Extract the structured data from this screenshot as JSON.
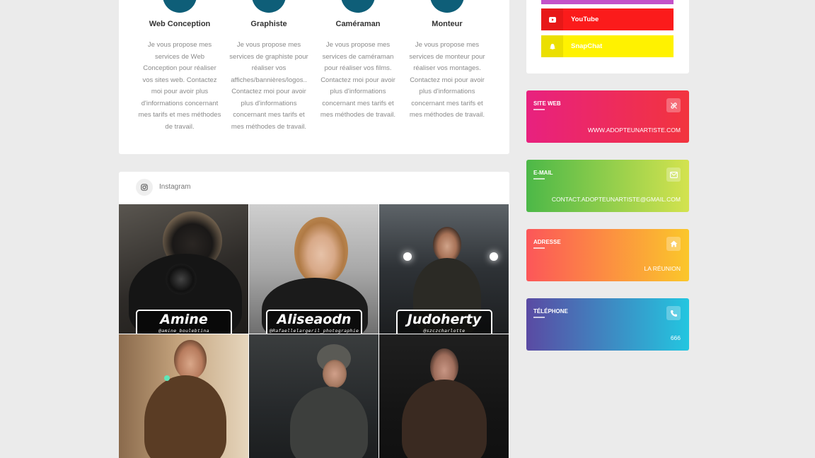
{
  "services": [
    {
      "title": "Web Conception",
      "description": "Je vous propose mes services de Web Conception pour réaliser vos sites web. Contactez moi pour avoir plus d'informations concernant mes tarifs et mes méthodes de travail."
    },
    {
      "title": "Graphiste",
      "description": "Je vous propose mes services de graphiste pour réaliser vos affiches/bannières/logos.. Contactez moi pour avoir plus d'informations concernant mes tarifs et mes méthodes de travail."
    },
    {
      "title": "Caméraman",
      "description": "Je vous propose mes services de caméraman pour réaliser vos films. Contactez moi pour avoir plus d'informations concernant mes tarifs et mes méthodes de travail."
    },
    {
      "title": "Monteur",
      "description": "Je vous propose mes services de monteur pour réaliser vos montages. Contactez moi pour avoir plus d'informations concernant mes tarifs et mes méthodes de travail."
    }
  ],
  "instagram": {
    "title": "Instagram",
    "icon": "instagram-icon",
    "posts": [
      {
        "name": "Amine",
        "handle": "@amine_boulebtina"
      },
      {
        "name": "Aliseaodn",
        "handle": "@Rafaellelargeril_photographie"
      },
      {
        "name": "Judoherty",
        "handle": "@szczcharlotte"
      },
      {
        "name": "",
        "handle": ""
      },
      {
        "name": "",
        "handle": ""
      },
      {
        "name": "",
        "handle": ""
      }
    ]
  },
  "social": [
    {
      "label": "YouTube",
      "icon": "youtube-icon",
      "color": "#fb1b1b"
    },
    {
      "label": "SnapChat",
      "icon": "snapchat-icon",
      "color": "#fff200"
    }
  ],
  "contact": [
    {
      "label": "SITE WEB",
      "value": "WWW.ADOPTEUNARTISTE.COM",
      "icon": "link-icon",
      "gradient": [
        "#e8217f",
        "#f2343e"
      ]
    },
    {
      "label": "E-MAIL",
      "value": "CONTACT.ADOPTEUNARTISTE@GMAIL.COM",
      "icon": "envelope-icon",
      "gradient": [
        "#4cb848",
        "#d4e34f"
      ]
    },
    {
      "label": "ADRESSE",
      "value": "LA RÉUNION",
      "icon": "home-icon",
      "gradient": [
        "#fc5659",
        "#fbc72a"
      ]
    },
    {
      "label": "TÉLÉPHONE",
      "value": "666",
      "icon": "phone-icon",
      "gradient": [
        "#5a4aa3",
        "#23c6e0"
      ]
    }
  ]
}
